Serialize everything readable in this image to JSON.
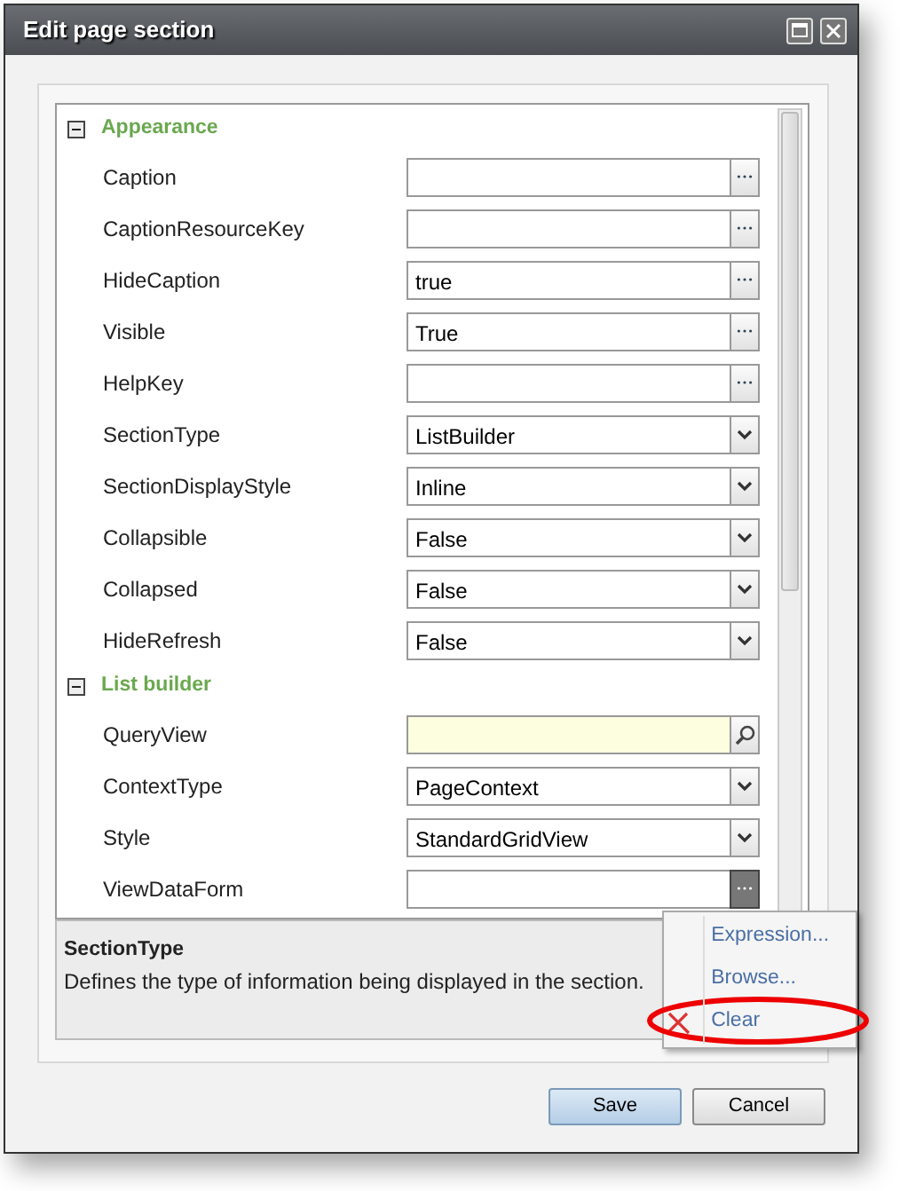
{
  "window": {
    "title": "Edit page section"
  },
  "groups": [
    {
      "name": "Appearance",
      "expanded": true,
      "properties": [
        {
          "label": "Caption",
          "kind": "text",
          "pressed": false
        },
        {
          "label": "CaptionResourceKey",
          "kind": "text",
          "pressed": false
        },
        {
          "label": "HideCaption",
          "kind": "text",
          "value": "true",
          "pressed": false
        },
        {
          "label": "Visible",
          "kind": "text",
          "value": "True",
          "pressed": false
        },
        {
          "label": "HelpKey",
          "kind": "text",
          "pressed": false
        },
        {
          "label": "SectionType",
          "kind": "select",
          "value": "ListBuilder",
          "pressed": false
        },
        {
          "label": "SectionDisplayStyle",
          "kind": "select",
          "value": "Inline",
          "pressed": false
        },
        {
          "label": "Collapsible",
          "kind": "select",
          "value": "False",
          "pressed": false
        },
        {
          "label": "Collapsed",
          "kind": "select",
          "value": "False",
          "pressed": false
        },
        {
          "label": "HideRefresh",
          "kind": "select",
          "value": "False",
          "pressed": false
        }
      ]
    },
    {
      "name": "List builder",
      "expanded": true,
      "properties": [
        {
          "label": "QueryView",
          "kind": "lookup",
          "pressed": false
        },
        {
          "label": "ContextType",
          "kind": "select",
          "value": "PageContext",
          "pressed": false
        },
        {
          "label": "Style",
          "kind": "select",
          "value": "StandardGridView",
          "pressed": false
        },
        {
          "label": "ViewDataForm",
          "kind": "text",
          "pressed": true
        }
      ]
    }
  ],
  "description": {
    "title": "SectionType",
    "text": "Defines the type of information being displayed in the section."
  },
  "context_menu": {
    "items": [
      {
        "label": "Expression...",
        "kind": "plain",
        "circled": false
      },
      {
        "label": "Browse...",
        "kind": "plain",
        "circled": false
      },
      {
        "label": "Clear",
        "kind": "clear",
        "circled": true
      }
    ]
  },
  "buttons": [
    {
      "label": "Save",
      "kind": "primary"
    },
    {
      "label": "Cancel",
      "kind": "secondary"
    }
  ]
}
